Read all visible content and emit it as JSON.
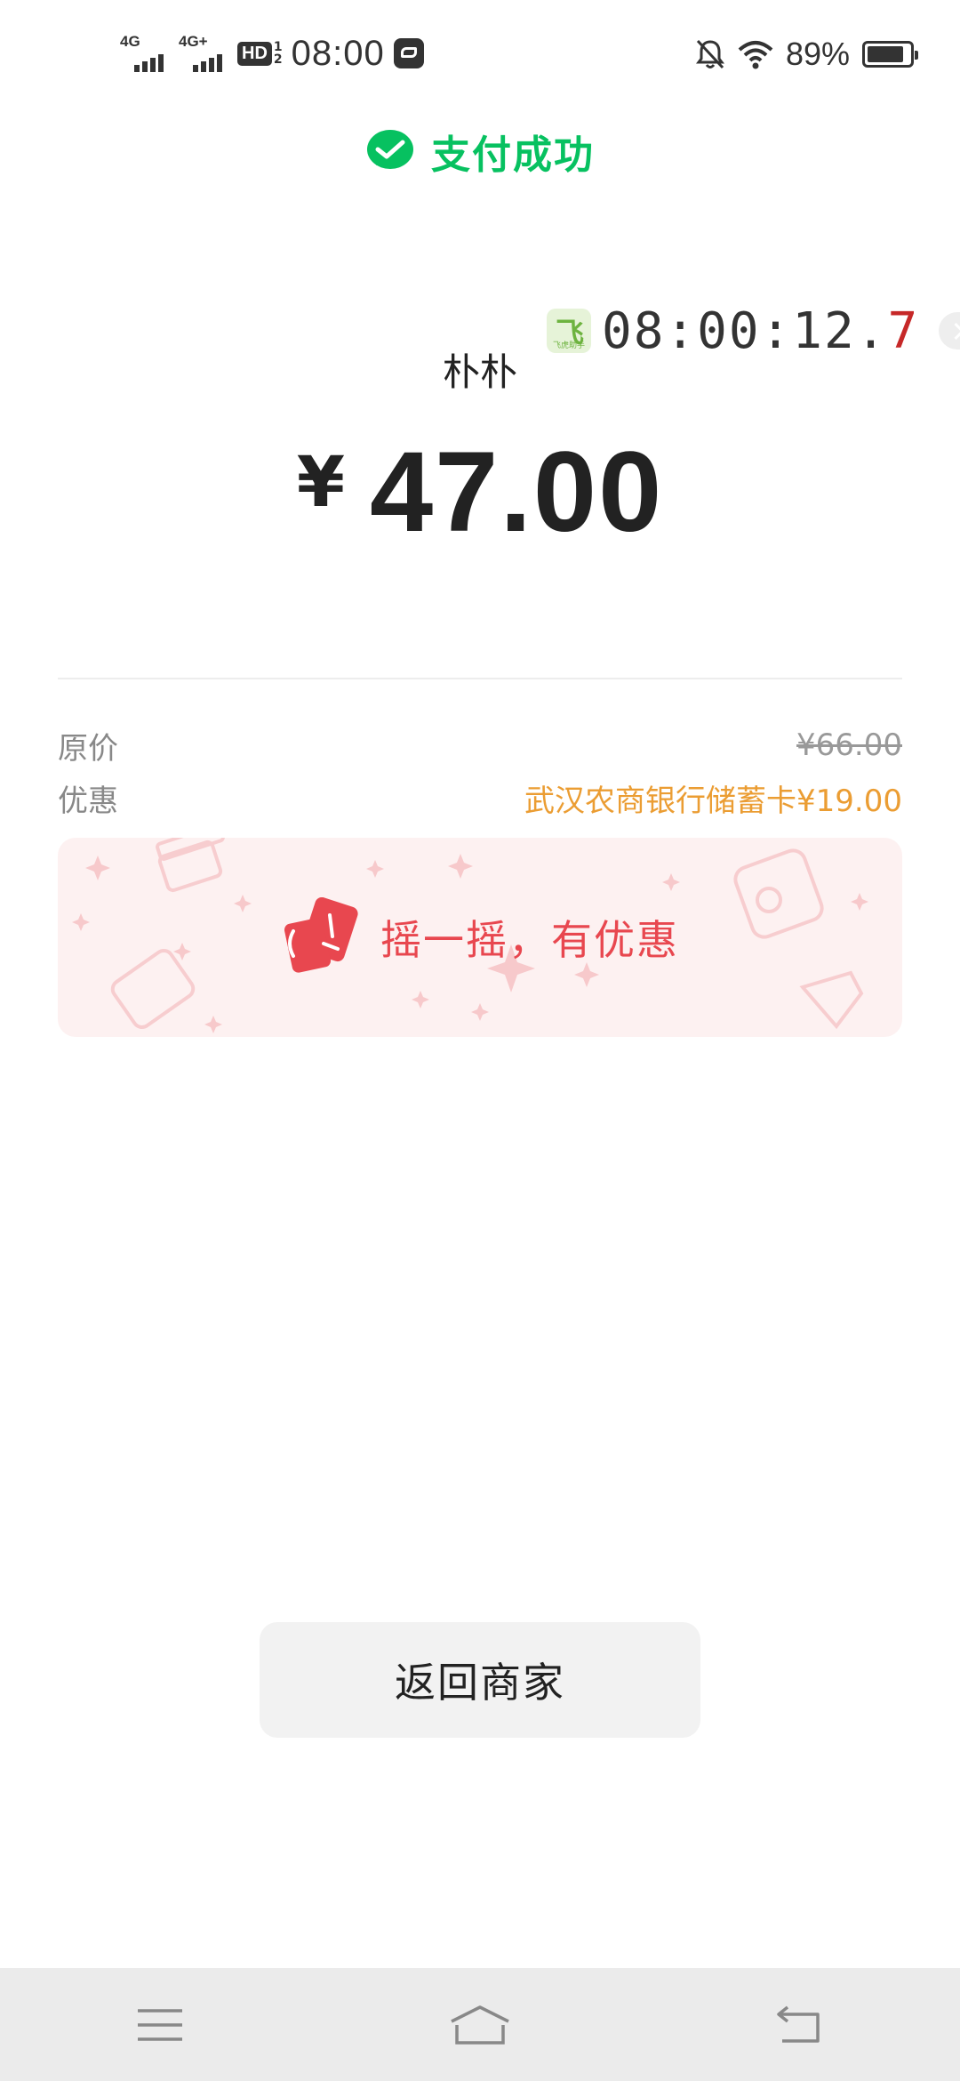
{
  "status_bar": {
    "signal1_label": "4G",
    "signal2_label": "4G+",
    "hd_label": "HD",
    "hd_frac_top": "1",
    "hd_frac_bottom": "2",
    "time": "08:00",
    "battery_percent": "89%",
    "battery_level": 0.89,
    "icons": [
      "signal-icon",
      "signal-icon",
      "hd-voice-icon",
      "message-icon",
      "bell-off-icon",
      "wifi-icon",
      "battery-icon"
    ]
  },
  "header": {
    "title": "支付成功",
    "icon": "wechat-pay-icon",
    "accent_color": "#07c160"
  },
  "timer_widget": {
    "app_glyph": "飞",
    "app_caption": "飞虎助手",
    "time_main": "08:00:12.",
    "time_tenths": "7"
  },
  "payment": {
    "merchant": "朴朴",
    "currency_symbol": "¥",
    "amount": "47.00"
  },
  "details": {
    "original_label": "原价",
    "original_value": "¥66.00",
    "discount_label": "优惠",
    "discount_value": "武汉农商银行储蓄卡¥19.00",
    "discount_color": "#eb9d33"
  },
  "promo": {
    "text": "摇一摇，有优惠",
    "color": "#e8474f"
  },
  "actions": {
    "back_label": "返回商家"
  },
  "nav_bar": {
    "items": [
      "menu-icon",
      "home-icon",
      "back-icon"
    ]
  }
}
